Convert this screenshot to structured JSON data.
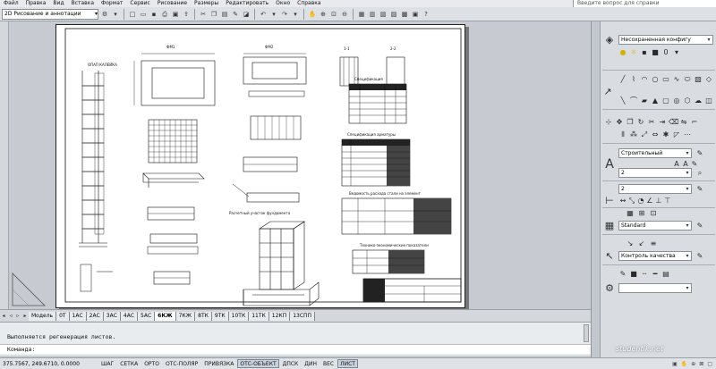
{
  "menu": {
    "items": [
      "Файл",
      "Правка",
      "Вид",
      "Вставка",
      "Формат",
      "Сервис",
      "Рисование",
      "Размеры",
      "Редактировать",
      "Окно",
      "Справка"
    ],
    "search_placeholder": "Введите вопрос для справки"
  },
  "toolbar": {
    "workspace": "2D Рисование и аннотации"
  },
  "layout_tabs": {
    "items": [
      "Модель",
      "0Т",
      "1АС",
      "2АС",
      "3АС",
      "4АС",
      "5АС",
      "6КЖ",
      "7КЖ",
      "8ТК",
      "9ТК",
      "10ТК",
      "11ТК",
      "12КП",
      "13СПП"
    ]
  },
  "command": {
    "history": "Выполняется регенерация листов.",
    "prompt": "Команда:"
  },
  "status": {
    "coordinates": "375.7567, 249.6710, 0.0000",
    "toggles": [
      {
        "label": "ШАГ",
        "on": false
      },
      {
        "label": "СЕТКА",
        "on": false
      },
      {
        "label": "ОРТО",
        "on": false
      },
      {
        "label": "ОТС-ПОЛЯР",
        "on": false
      },
      {
        "label": "ПРИВЯЗКА",
        "on": false
      },
      {
        "label": "ОТС-ОБЪЕКТ",
        "on": true
      },
      {
        "label": "ДПСК",
        "on": false
      },
      {
        "label": "ДИН",
        "on": false
      },
      {
        "label": "ВЕС",
        "on": false
      },
      {
        "label": "ЛИСТ",
        "on": true
      }
    ]
  },
  "panel": {
    "layer_state": "Несохраненная конфигу",
    "text_style": "Строительный",
    "text_height": "2",
    "dim_scale": "2",
    "table_style": "Standard",
    "mleader_style": "Контроль качества"
  },
  "drawing": {
    "labels": [
      "ОПАП КАЛЕЙКА",
      "ФМ1",
      "ФМ2",
      "1-1",
      "2-2",
      "Спецификация",
      "Спецификация арматуры",
      "Ведомость расхода стали на элемент",
      "Технико-экономические показатели",
      "Расчетный участок фундамента"
    ]
  },
  "watermark": "studentik.net"
}
